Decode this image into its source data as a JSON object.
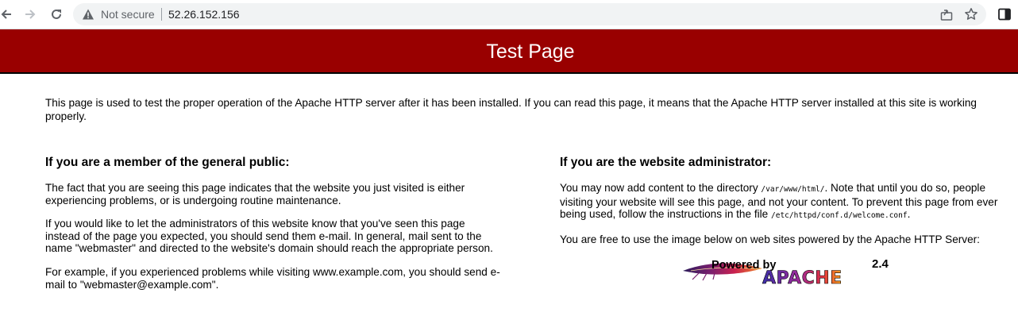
{
  "browser": {
    "security_label": "Not secure",
    "url": "52.26.152.156"
  },
  "page": {
    "title": "Test Page",
    "intro": "This page is used to test the proper operation of the Apache HTTP server after it has been installed. If you can read this page, it means that the Apache HTTP server installed at this site is working properly.",
    "public": {
      "heading": "If you are a member of the general public:",
      "p1": "The fact that you are seeing this page indicates that the website you just visited is either experiencing problems, or is undergoing routine maintenance.",
      "p2": "If you would like to let the administrators of this website know that you've seen this page instead of the page you expected, you should send them e-mail. In general, mail sent to the name \"webmaster\" and directed to the website's domain should reach the appropriate person.",
      "p3": "For example, if you experienced problems while visiting www.example.com, you should send e-mail to \"webmaster@example.com\"."
    },
    "admin": {
      "heading": "If you are the website administrator:",
      "p1_a": "You may now add content to the directory ",
      "p1_dir": "/var/www/html/",
      "p1_b": ". Note that until you do so, people visiting your website will see this page, and not your content. To prevent this page from ever being used, follow the instructions in the file ",
      "p1_file": "/etc/httpd/conf.d/welcome.conf",
      "p1_c": ".",
      "p2": "You are free to use the image below on web sites powered by the Apache HTTP Server:"
    },
    "logo": {
      "powered_by": "Powered by",
      "version": "2.4",
      "name": "APACHE"
    }
  },
  "colors": {
    "banner": "#990000"
  }
}
